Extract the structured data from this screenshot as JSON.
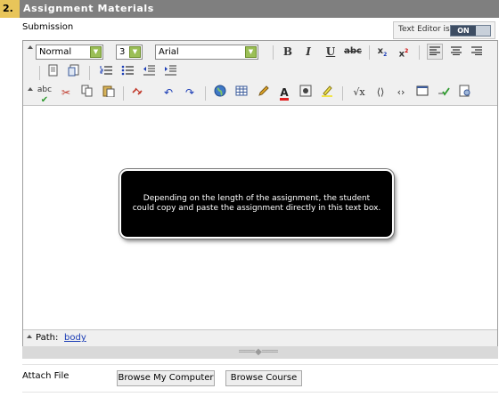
{
  "section": {
    "number": "2.",
    "title": "Assignment Materials"
  },
  "submission_label": "Submission",
  "text_editor": {
    "label": "Text Editor is:",
    "state": "ON"
  },
  "toolbar": {
    "format_select": "Normal",
    "size_select": "3",
    "font_select": "Arial",
    "bold": "B",
    "italic": "I",
    "underline": "U",
    "strikethrough": "abc",
    "subscript": "x",
    "subscript_mark": "2",
    "superscript": "x",
    "superscript_mark": "2",
    "spellcheck": "abc",
    "math": "√x"
  },
  "tooltip": "Depending on the length of the assignment, the student could copy and paste the assignment directly in this text box.",
  "path": {
    "label": "Path:",
    "value": "body"
  },
  "attach_label": "Attach File",
  "buttons": {
    "browse_computer": "Browse My Computer",
    "browse_course": "Browse Course"
  },
  "colors": {
    "header_bg": "#7f7f7f",
    "header_number_bg": "#e8c55a",
    "toggle_on": "#3d4d63",
    "path_link": "#1a3cb5"
  }
}
